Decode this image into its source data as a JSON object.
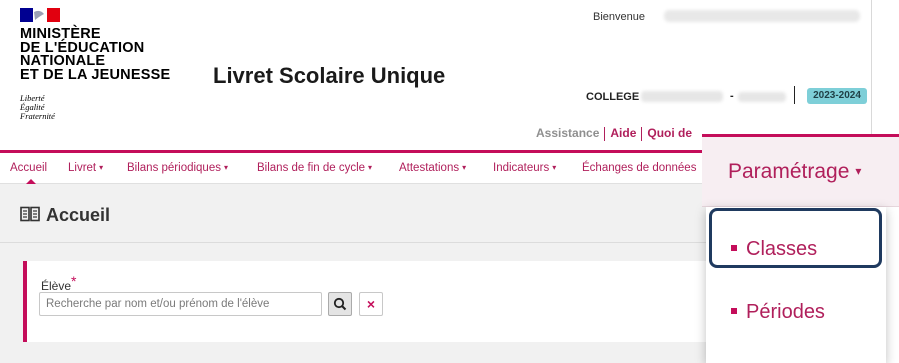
{
  "header": {
    "ministry_lines": [
      "MINISTÈRE",
      "DE L'ÉDUCATION",
      "NATIONALE",
      "ET DE LA JEUNESSE"
    ],
    "motto_lines": [
      "Liberté",
      "Égalité",
      "Fraternité"
    ],
    "app_title": "Livret Scolaire Unique",
    "welcome": "Bienvenue",
    "school_type": "COLLEGE",
    "school_separator": "-",
    "year": "2023-2024"
  },
  "top_links": {
    "assistance": "Assistance",
    "aide": "Aide",
    "quoi_de": "Quoi de"
  },
  "nav": {
    "items": [
      {
        "label": "Accueil",
        "has_caret": false
      },
      {
        "label": "Livret",
        "has_caret": true
      },
      {
        "label": "Bilans périodiques",
        "has_caret": true
      },
      {
        "label": "Bilans de fin de cycle",
        "has_caret": true
      },
      {
        "label": "Attestations",
        "has_caret": true
      },
      {
        "label": "Indicateurs",
        "has_caret": true
      },
      {
        "label": "Échanges de données",
        "has_caret": false
      }
    ],
    "caret": "▾"
  },
  "main": {
    "page_title": "Accueil",
    "student_label": "Élève",
    "required_mark": "*",
    "search_placeholder": "Recherche par nom et/ou prénom de l'élève",
    "clear_symbol": "×"
  },
  "zoom_menu": {
    "button_label": "Paramétrage",
    "caret": "▾",
    "items": [
      "Classes",
      "Périodes"
    ],
    "highlighted_item": "Périodes"
  },
  "colors": {
    "accent": "#c40d5a",
    "link": "#b01f5b",
    "year_badge": "#7ecfd8",
    "highlight_border": "#1f3a5f"
  }
}
